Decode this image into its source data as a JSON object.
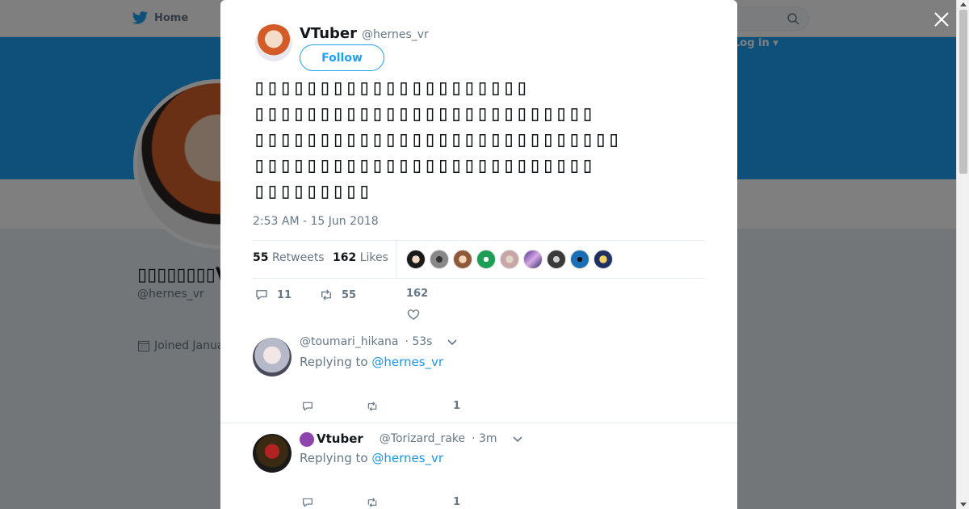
{
  "nav": {
    "home_label": "Home",
    "login_label": "Log in ▾"
  },
  "profile": {
    "name": "▯▯▯▯▯▯▯▯VTuber",
    "handle": "@hernes_vr",
    "joined": "Joined January"
  },
  "tweet": {
    "author_name": "VTuber",
    "author_handle": "@hernes_vr",
    "follow_label": "Follow",
    "text": "▯▯▯▯▯▯▯▯▯▯▯▯▯▯▯▯▯▯▯▯▯\n▯▯▯▯▯▯▯▯▯▯▯▯▯▯▯▯▯▯▯▯▯▯▯▯▯▯\n▯▯▯▯▯▯▯▯▯▯▯▯▯▯▯▯▯▯▯▯▯▯▯▯▯▯▯▯\n▯▯▯▯▯▯▯▯▯▯▯▯▯▯▯▯▯▯▯▯▯▯▯▯▯▯\n▯▯▯▯▯▯▯▯▯",
    "timestamp": "2:53 AM - 15 Jun 2018",
    "retweets_count": "55",
    "retweets_label": "Retweets",
    "likes_count": "162",
    "likes_label": "Likes",
    "reply_count": "11",
    "retweet_count_action": "55",
    "like_count_action": "162"
  },
  "replies": [
    {
      "name": "",
      "handle": "@toumari_hikana",
      "time": "· 53s",
      "replying_prefix": "Replying to ",
      "replying_to": "@hernes_vr",
      "like_count": "1"
    },
    {
      "name": "Vtuber",
      "handle": "@Torizard_rake",
      "time": "· 3m",
      "replying_prefix": "Replying to ",
      "replying_to": "@hernes_vr",
      "like_count": "1"
    }
  ],
  "colors": {
    "accent": "#1da1f2",
    "link": "#1b95e0",
    "muted": "#657786"
  },
  "icons": [
    "twitter-bird-icon",
    "search-icon",
    "close-icon",
    "calendar-icon",
    "reply-icon",
    "retweet-icon",
    "heart-icon",
    "chevron-down-icon"
  ]
}
